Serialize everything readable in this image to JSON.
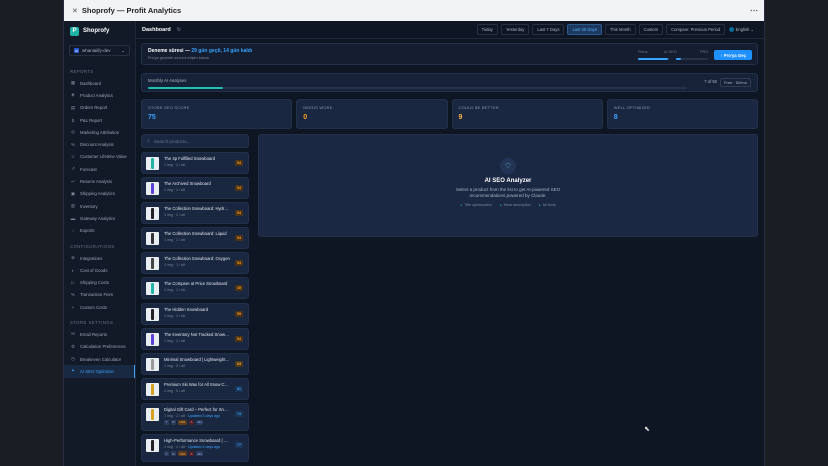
{
  "window": {
    "title": "Shoprofy — Profit Analytics"
  },
  "brand": {
    "name": "Shoprofy"
  },
  "store": {
    "initial": "W",
    "name": "whaniaiify-dev"
  },
  "sidebar": {
    "reports_title": "REPORTS",
    "reports": [
      {
        "icon": "▦",
        "label": "Dashboard"
      },
      {
        "icon": "◈",
        "label": "Product Analytics"
      },
      {
        "icon": "▤",
        "label": "Orders Report"
      },
      {
        "icon": "$",
        "label": "P&L Report"
      },
      {
        "icon": "◎",
        "label": "Marketing Attribution"
      },
      {
        "icon": "%",
        "label": "Discount Analysis"
      },
      {
        "icon": "☺",
        "label": "Customer Lifetime Value"
      },
      {
        "icon": "↗",
        "label": "Forecast"
      },
      {
        "icon": "↩",
        "label": "Returns Analysis"
      },
      {
        "icon": "▣",
        "label": "Shipping Analytics"
      },
      {
        "icon": "▥",
        "label": "Inventory"
      },
      {
        "icon": "▬",
        "label": "Gateway Analytics"
      },
      {
        "icon": "↓",
        "label": "Exports"
      }
    ],
    "config_title": "CONFIGURATIONS",
    "config": [
      {
        "icon": "⊕",
        "label": "Integrations"
      },
      {
        "icon": "◐",
        "label": "Cost of Goods"
      },
      {
        "icon": "▷",
        "label": "Shipping Costs"
      },
      {
        "icon": "%",
        "label": "Transaction Fees"
      },
      {
        "icon": "+",
        "label": "Custom Costs"
      }
    ],
    "settings_title": "STORE SETTINGS",
    "settings": [
      {
        "icon": "✉",
        "label": "Email Reports"
      },
      {
        "icon": "⚙",
        "label": "Calculation Preferences"
      },
      {
        "icon": "◷",
        "label": "Breakeven Calculator"
      },
      {
        "icon": "✦",
        "label": "AI SEO Optimizer"
      }
    ]
  },
  "topbar": {
    "title": "Dashboard",
    "ranges": [
      "Today",
      "Yesterday",
      "Last 7 Days",
      "Last 30 Days",
      "This Month",
      "Custom",
      "Compare: Previous Period"
    ],
    "active_range": "Last 30 Days",
    "language": "English"
  },
  "trial": {
    "title": "Deneme süresi —",
    "highlight": "29 gün geçti, 14 gün kaldı",
    "subtitle": "Pro'ya geçerek sınırsız erişim kazan",
    "meter_labels": [
      "Plans",
      "AI SEO",
      "PRO"
    ],
    "meter_values": [
      0.95,
      0.15
    ],
    "upgrade_label": "↑ Pro'ya Geç"
  },
  "monthly": {
    "label": "Monthly AI Analyses",
    "count": "7 of 50",
    "plan": "Free · 50/mo",
    "progress": 0.14
  },
  "cards": [
    {
      "label": "STORE SEO SCORE",
      "value": "75",
      "color": "#3aa3ff"
    },
    {
      "label": "NEEDS WORK",
      "value": "0",
      "color": "#ff9f1a"
    },
    {
      "label": "COULD BE BETTER",
      "value": "9",
      "color": "#ffb347"
    },
    {
      "label": "WELL OPTIMIZED",
      "value": "8",
      "color": "#3aa3ff"
    }
  ],
  "search": {
    "placeholder": "Search products..."
  },
  "products": [
    {
      "name": "The 3p Fulfilled Snowboard",
      "meta": "1 img · 1 / alt",
      "score": "54",
      "sc_color": "#ff9f1a",
      "sc_bg": "#4a3318",
      "thumb": "#20b2a6"
    },
    {
      "name": "The Archived Snowboard",
      "meta": "1 img · 1 / alt",
      "score": "54",
      "sc_color": "#ff9f1a",
      "sc_bg": "#4a3318",
      "thumb": "#5b3fd6"
    },
    {
      "name": "The Collection Snowboard: Hydrogen",
      "meta": "1 img · 1 / alt",
      "score": "54",
      "sc_color": "#ff9f1a",
      "sc_bg": "#4a3318",
      "thumb": "#222"
    },
    {
      "name": "The Collection Snowboard: Liquid",
      "meta": "1 img · 1 / alt",
      "score": "54",
      "sc_color": "#ff9f1a",
      "sc_bg": "#4a3318",
      "thumb": "#333"
    },
    {
      "name": "The Collection Snowboard: Oxygen",
      "meta": "1 img · 1 / alt",
      "score": "54",
      "sc_color": "#ff9f1a",
      "sc_bg": "#4a3318",
      "thumb": "#444"
    },
    {
      "name": "The Compare at Price Snowboard",
      "meta": "1 img · 1 / alt",
      "score": "45",
      "sc_color": "#ff9f1a",
      "sc_bg": "#4a3318",
      "thumb": "#20b2a6"
    },
    {
      "name": "The Hidden Snowboard",
      "meta": "1 img · 1 / alt",
      "score": "55",
      "sc_color": "#ff9f1a",
      "sc_bg": "#4a3318",
      "thumb": "#222"
    },
    {
      "name": "The Inventory Not Tracked Snowboard",
      "meta": "1 img · 1 / alt",
      "score": "54",
      "sc_color": "#ff9f1a",
      "sc_bg": "#4a3318",
      "thumb": "#5b3fd6"
    },
    {
      "name": "Minimal Snowboard | Lightweight & Durable",
      "meta": "1 img · 0 / alt",
      "score": "63",
      "sc_color": "#ffb347",
      "sc_bg": "#4a3a18",
      "thumb": "#999"
    },
    {
      "name": "Premium Ski Wax for All Snow Conditions",
      "meta": "1 img · 0 / alt",
      "score": "81",
      "sc_color": "#3aa3ff",
      "sc_bg": "#1b3556",
      "thumb": "#d6a020"
    },
    {
      "name": "Digital Gift Card – Perfect for Snowboarders",
      "meta": "1 img · 1 / alt ·",
      "meta_hl": "Updated 5 days ago",
      "score": "74",
      "sc_color": "#3aa3ff",
      "sc_bg": "#1b3556",
      "thumb": "#d6a020",
      "tags": [
        [
          "T",
          "b"
        ],
        [
          "D",
          "b"
        ],
        [
          "URL",
          "o"
        ],
        [
          "A",
          "r"
        ],
        [
          "AH",
          "b"
        ]
      ]
    },
    {
      "name": "High-Performance Snowboard | Woodcore",
      "meta": "1 img · 1 / alt ·",
      "meta_hl": "Updated 4 days ago",
      "score": "77",
      "sc_color": "#3aa3ff",
      "sc_bg": "#1b3556",
      "thumb": "#222",
      "tags": [
        [
          "T",
          "b"
        ],
        [
          "D",
          "b"
        ],
        [
          "URL",
          "o"
        ],
        [
          "A",
          "r"
        ],
        [
          "AH",
          "b"
        ]
      ]
    }
  ],
  "analyzer": {
    "icon": "♡",
    "title": "AI SEO Analyzer",
    "description": "Select a product from the list to get AI-powered SEO recommendations powered by Claude.",
    "features": [
      "Title optimization",
      "Meta description",
      "Alt texts"
    ]
  }
}
